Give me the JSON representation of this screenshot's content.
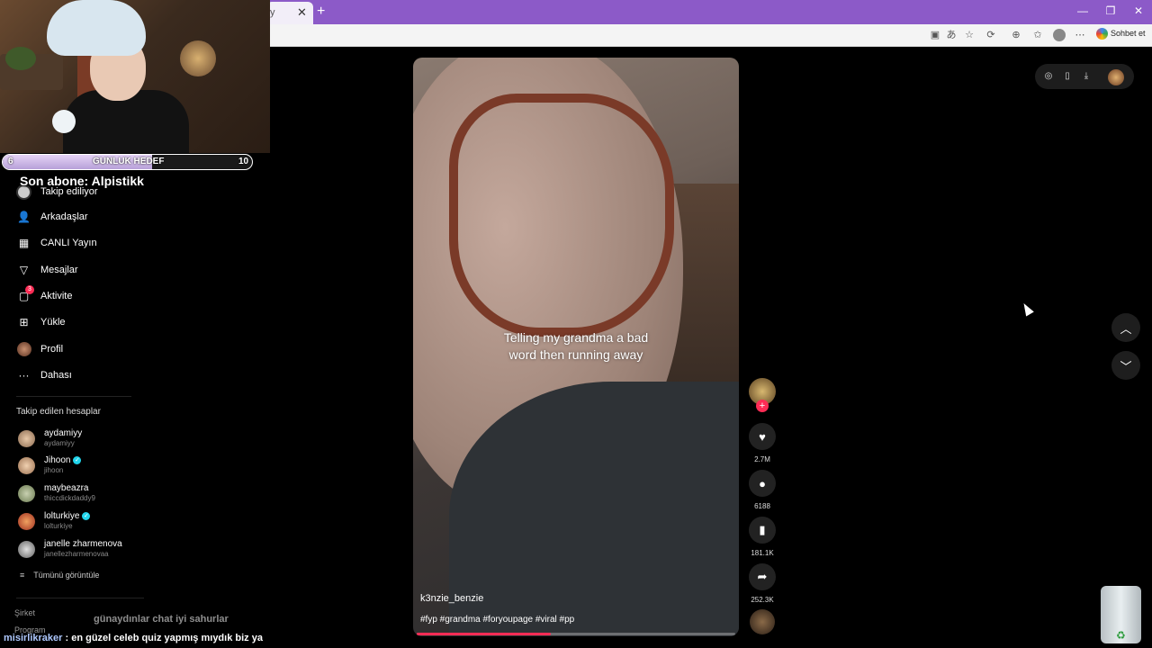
{
  "browser": {
    "tab_title": "y",
    "tab_close": "✕",
    "new_tab": "+",
    "window_controls": {
      "minimize": "—",
      "restore": "❐",
      "close": "✕"
    },
    "toolbar_icons": [
      "screen-icon",
      "translate-icon",
      "star-icon",
      "refresh-icon",
      "collections-icon",
      "favorites-icon",
      "profile-icon",
      "more-icon"
    ],
    "copilot_label": "Sohbet et"
  },
  "stream": {
    "goal": {
      "current": "6",
      "label": "GUNLUK HEDEF",
      "target": "10",
      "progress": 0.6
    },
    "last_subscriber": "Son abone: Alpistikk"
  },
  "sidebar": {
    "items": [
      {
        "label": "Takip ediliyor",
        "icon": "following-icon"
      },
      {
        "label": "Arkadaşlar",
        "icon": "friends-icon"
      },
      {
        "label": "CANLI Yayın",
        "icon": "live-icon"
      },
      {
        "label": "Mesajlar",
        "icon": "messages-icon"
      },
      {
        "label": "Aktivite",
        "icon": "activity-icon",
        "badge": "3"
      },
      {
        "label": "Yükle",
        "icon": "upload-icon"
      },
      {
        "label": "Profil",
        "icon": "profile-icon"
      },
      {
        "label": "Dahası",
        "icon": "more-icon"
      }
    ],
    "followed_heading": "Takip edilen hesaplar",
    "followed_accounts": [
      {
        "name": "aydamiyy",
        "username": "aydamiyy",
        "verified": false
      },
      {
        "name": "Jihoon",
        "username": "jihoon",
        "verified": true
      },
      {
        "name": "maybeazra",
        "username": "thiccdickdaddy9",
        "verified": false
      },
      {
        "name": "lolturkiye",
        "username": "lolturkiye",
        "verified": true
      },
      {
        "name": "janelle zharmenova",
        "username": "janellezharmenovaa",
        "verified": false
      }
    ],
    "see_all": "Tümünü görüntüle",
    "footer": [
      "Şirket",
      "Program"
    ]
  },
  "chat": [
    {
      "user": "",
      "message": "günaydınlar chat iyi sahurlar"
    },
    {
      "user": "misirlikraker",
      "message": ": en güzel celeb quiz yapmış mıydık biz ya"
    }
  ],
  "video": {
    "caption_line1": "Telling my grandma a bad",
    "caption_line2": "word then running away",
    "author": "k3nzie_benzie",
    "hashtags": "#fyp #grandma #foryoupage #viral #pp",
    "progress": 0.42
  },
  "actions": {
    "likes": "2.7M",
    "comments": "6188",
    "saves": "181.1K",
    "shares": "252.3K"
  },
  "colors": {
    "accent": "#fe2c55",
    "tabbar": "#8c5ac8",
    "verified": "#20d5ec"
  }
}
